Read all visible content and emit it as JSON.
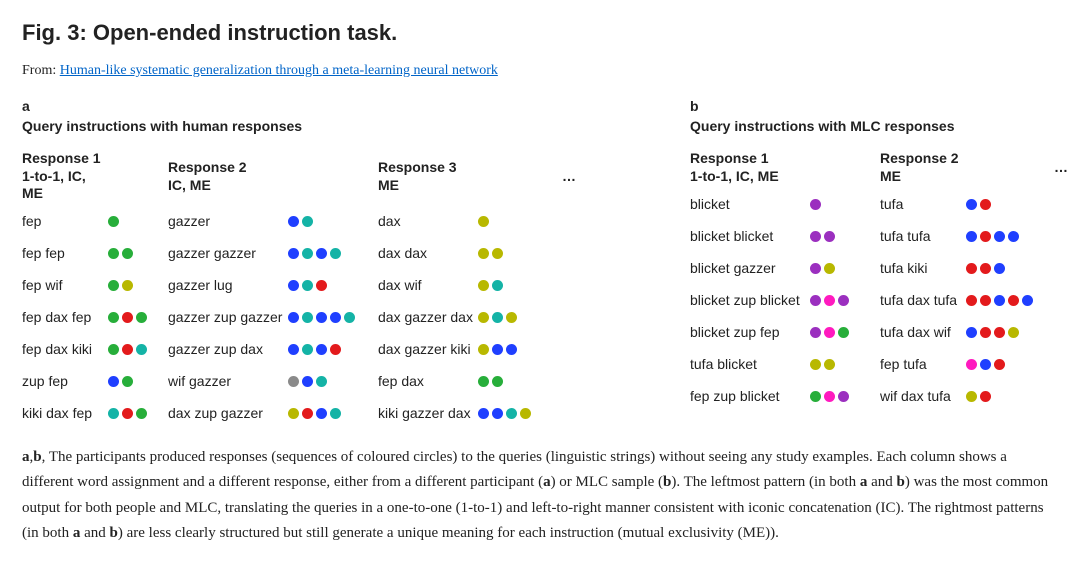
{
  "title": "Fig. 3: Open-ended instruction task.",
  "from_prefix": "From: ",
  "from_link": "Human-like systematic generalization through a meta-learning neural network",
  "ellipsis": "…",
  "colors": {
    "green": "#27ae3a",
    "olive": "#b8b800",
    "red": "#e31a1c",
    "teal": "#14b3a6",
    "blue": "#1f3fff",
    "purple": "#9b2fbf",
    "magenta": "#ff1abf",
    "gray": "#8a8a8a"
  },
  "panel_a": {
    "label": "a",
    "title": "Query instructions with human responses",
    "columns": [
      {
        "title": "Response 1",
        "sub": "1-to-1, IC, ME"
      },
      {
        "title": "Response 2",
        "sub": "IC, ME"
      },
      {
        "title": "Response 3",
        "sub": "ME"
      }
    ],
    "rows": [
      {
        "c": [
          {
            "q": "fep",
            "d": [
              "green"
            ]
          },
          {
            "q": "gazzer",
            "d": [
              "blue",
              "teal"
            ]
          },
          {
            "q": "dax",
            "d": [
              "olive"
            ]
          }
        ]
      },
      {
        "c": [
          {
            "q": "fep fep",
            "d": [
              "green",
              "green"
            ]
          },
          {
            "q": "gazzer gazzer",
            "d": [
              "blue",
              "teal",
              "blue",
              "teal"
            ]
          },
          {
            "q": "dax dax",
            "d": [
              "olive",
              "olive"
            ]
          }
        ]
      },
      {
        "c": [
          {
            "q": "fep wif",
            "d": [
              "green",
              "olive"
            ]
          },
          {
            "q": "gazzer lug",
            "d": [
              "blue",
              "teal",
              "red"
            ]
          },
          {
            "q": "dax wif",
            "d": [
              "olive",
              "teal"
            ]
          }
        ]
      },
      {
        "c": [
          {
            "q": "fep dax fep",
            "d": [
              "green",
              "red",
              "green"
            ]
          },
          {
            "q": "gazzer zup gazzer",
            "d": [
              "blue",
              "teal",
              "blue",
              "blue",
              "teal"
            ]
          },
          {
            "q": "dax gazzer dax",
            "d": [
              "olive",
              "teal",
              "olive"
            ]
          }
        ]
      },
      {
        "c": [
          {
            "q": "fep dax kiki",
            "d": [
              "green",
              "red",
              "teal"
            ]
          },
          {
            "q": "gazzer zup dax",
            "d": [
              "blue",
              "teal",
              "blue",
              "red"
            ]
          },
          {
            "q": "dax gazzer kiki",
            "d": [
              "olive",
              "blue",
              "blue"
            ]
          }
        ]
      },
      {
        "c": [
          {
            "q": "zup fep",
            "d": [
              "blue",
              "green"
            ]
          },
          {
            "q": "wif gazzer",
            "d": [
              "gray",
              "blue",
              "teal"
            ]
          },
          {
            "q": "fep dax",
            "d": [
              "green",
              "green"
            ]
          }
        ]
      },
      {
        "c": [
          {
            "q": "kiki dax fep",
            "d": [
              "teal",
              "red",
              "green"
            ]
          },
          {
            "q": "dax zup gazzer",
            "d": [
              "olive",
              "red",
              "blue",
              "teal"
            ]
          },
          {
            "q": "kiki gazzer dax",
            "d": [
              "blue",
              "blue",
              "teal",
              "olive"
            ]
          }
        ]
      }
    ]
  },
  "panel_b": {
    "label": "b",
    "title": "Query instructions with MLC responses",
    "columns": [
      {
        "title": "Response 1",
        "sub": "1-to-1, IC, ME"
      },
      {
        "title": "Response 2",
        "sub": "ME"
      }
    ],
    "rows": [
      {
        "c": [
          {
            "q": "blicket",
            "d": [
              "purple"
            ]
          },
          {
            "q": "tufa",
            "d": [
              "blue",
              "red"
            ]
          }
        ]
      },
      {
        "c": [
          {
            "q": "blicket blicket",
            "d": [
              "purple",
              "purple"
            ]
          },
          {
            "q": "tufa tufa",
            "d": [
              "blue",
              "red",
              "blue",
              "blue"
            ]
          }
        ]
      },
      {
        "c": [
          {
            "q": "blicket gazzer",
            "d": [
              "purple",
              "olive"
            ]
          },
          {
            "q": "tufa kiki",
            "d": [
              "red",
              "red",
              "blue"
            ]
          }
        ]
      },
      {
        "c": [
          {
            "q": "blicket zup blicket",
            "d": [
              "purple",
              "magenta",
              "purple"
            ]
          },
          {
            "q": "tufa dax tufa",
            "d": [
              "red",
              "red",
              "blue",
              "red",
              "blue"
            ]
          }
        ]
      },
      {
        "c": [
          {
            "q": "blicket zup fep",
            "d": [
              "purple",
              "magenta",
              "green"
            ]
          },
          {
            "q": "tufa dax wif",
            "d": [
              "blue",
              "red",
              "red",
              "olive"
            ]
          }
        ]
      },
      {
        "c": [
          {
            "q": "tufa blicket",
            "d": [
              "olive",
              "olive"
            ]
          },
          {
            "q": "fep tufa",
            "d": [
              "magenta",
              "blue",
              "red"
            ]
          }
        ]
      },
      {
        "c": [
          {
            "q": "fep zup blicket",
            "d": [
              "green",
              "magenta",
              "purple"
            ]
          },
          {
            "q": "wif dax tufa",
            "d": [
              "olive",
              "red"
            ]
          }
        ]
      }
    ]
  },
  "caption_parts": {
    "p1a": "a",
    "p1b": ",",
    "p1c": "b",
    "p1d": ", The participants produced responses (sequences of coloured circles) to the queries (linguistic strings) without seeing any study examples. Each column shows a different word assignment and a different response, either from a different participant (",
    "p1e": "a",
    "p1f": ") or MLC sample (",
    "p1g": "b",
    "p1h": "). The leftmost pattern (in both ",
    "p1i": "a",
    "p1j": " and ",
    "p1k": "b",
    "p1l": ") was the most common output for both people and MLC, translating the queries in a one-to-one (1-to-1) and left-to-right manner consistent with iconic concatenation (IC). The rightmost patterns (in both ",
    "p1m": "a",
    "p1n": " and ",
    "p1o": "b",
    "p1p": ") are less clearly structured but still generate a unique meaning for each instruction (mutual exclusivity (ME))."
  }
}
